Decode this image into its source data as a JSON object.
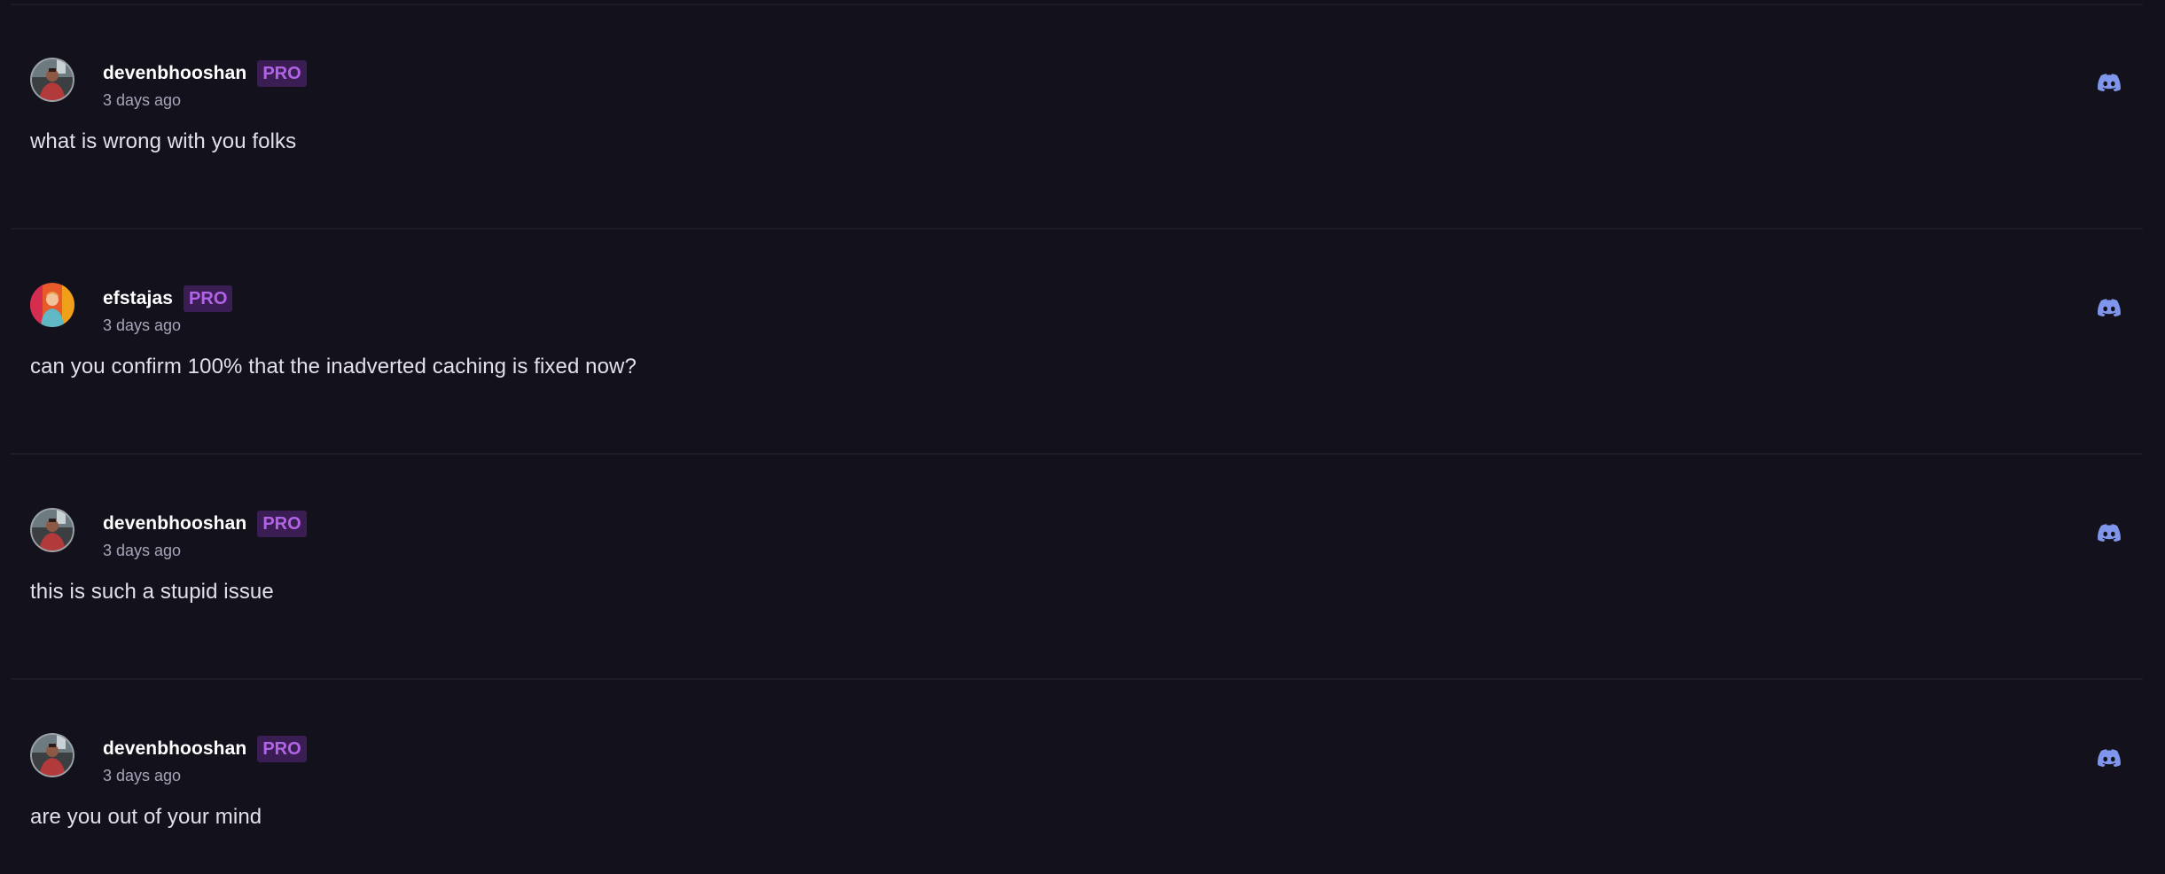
{
  "colors": {
    "background": "#13121c",
    "divider": "#1c1b28",
    "badge_bg": "#3a1d52",
    "badge_text": "#b165e6",
    "discord_icon": "#7f96ec"
  },
  "posts": [
    {
      "username": "devenbhooshan",
      "badge": "PRO",
      "timestamp": "3 days ago",
      "message": "what is wrong with you folks",
      "avatar_icon": "user-photo-avatar",
      "source_icon": "discord-icon"
    },
    {
      "username": "efstajas",
      "badge": "PRO",
      "timestamp": "3 days ago",
      "message": "can you confirm 100% that the inadverted caching is fixed now?",
      "avatar_icon": "user-photo-avatar",
      "source_icon": "discord-icon"
    },
    {
      "username": "devenbhooshan",
      "badge": "PRO",
      "timestamp": "3 days ago",
      "message": "this is such a stupid issue",
      "avatar_icon": "user-photo-avatar",
      "source_icon": "discord-icon"
    },
    {
      "username": "devenbhooshan",
      "badge": "PRO",
      "timestamp": "3 days ago",
      "message": "are you out of your mind",
      "avatar_icon": "user-photo-avatar",
      "source_icon": "discord-icon"
    }
  ]
}
